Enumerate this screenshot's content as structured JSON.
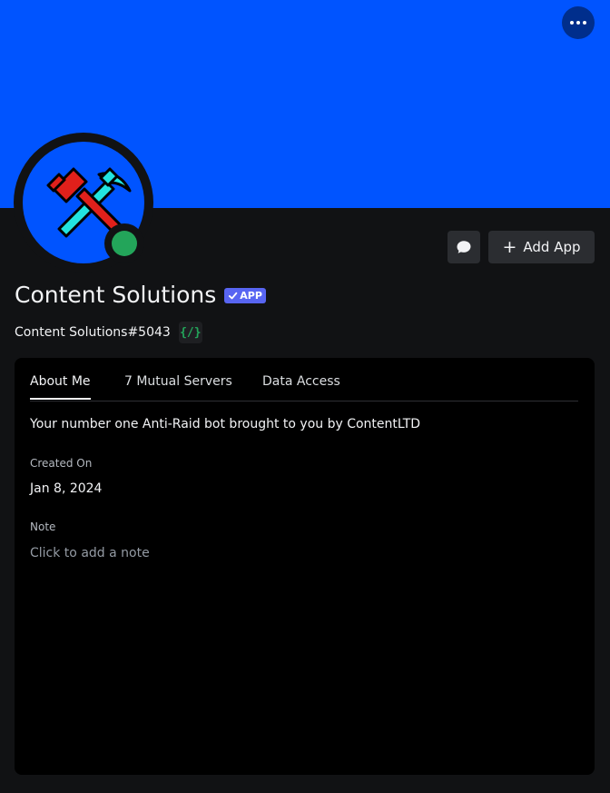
{
  "colors": {
    "banner": "#0054ff",
    "avatar_bg": "#0054ff",
    "status_online": "#23a55a",
    "app_badge": "#5865f2",
    "command_icon": "#23a55a"
  },
  "header": {
    "more_icon": "more-horizontal-icon"
  },
  "actions": {
    "message_icon": "chat-bubble-icon",
    "add_app_label": "Add App",
    "add_icon": "plus-icon"
  },
  "profile": {
    "display_name": "Content Solutions",
    "badge_label": "APP",
    "badge_icon": "checkmark-icon",
    "username": "Content Solutions#5043",
    "command_badge_text": "{/}",
    "avatar_icon": "hammer-pickaxe-icon",
    "status": "online"
  },
  "tabs": [
    {
      "label": "About Me",
      "active": true
    },
    {
      "label": "7 Mutual Servers",
      "active": false
    },
    {
      "label": "Data Access",
      "active": false
    }
  ],
  "about_me": "Your number one Anti-Raid bot brought to you by ContentLTD",
  "created_on": {
    "label": "Created On",
    "value": "Jan 8, 2024"
  },
  "note": {
    "label": "Note",
    "placeholder": "Click to add a note"
  }
}
